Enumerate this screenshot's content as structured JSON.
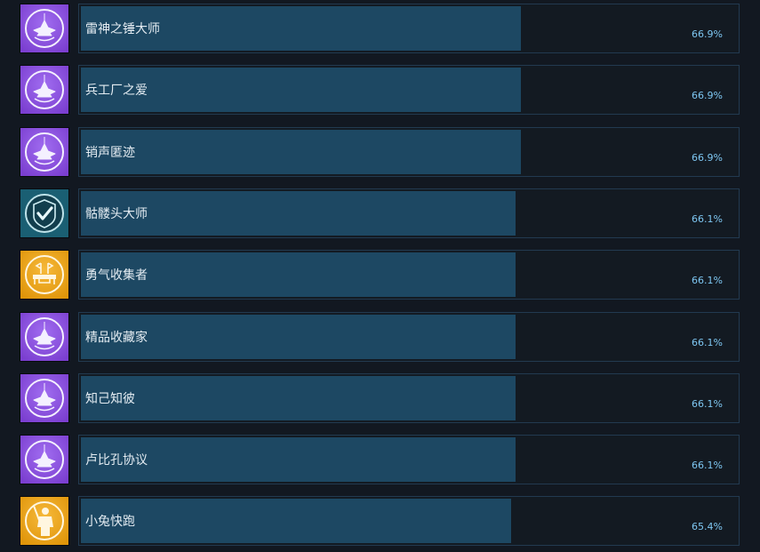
{
  "achievements": [
    {
      "name": "雷神之锤大师",
      "percent_label": "66.9%",
      "percent": 66.9,
      "icon": "tower-icon",
      "icon_color": "#7b3fd0"
    },
    {
      "name": "兵工厂之爱",
      "percent_label": "66.9%",
      "percent": 66.9,
      "icon": "tower-icon",
      "icon_color": "#7b3fd0"
    },
    {
      "name": "销声匿迹",
      "percent_label": "66.9%",
      "percent": 66.9,
      "icon": "tower-icon",
      "icon_color": "#7b3fd0"
    },
    {
      "name": "骷髅头大师",
      "percent_label": "66.1%",
      "percent": 66.1,
      "icon": "checkmark-shield-icon",
      "icon_color": "#1a5f73"
    },
    {
      "name": "勇气收集者",
      "percent_label": "66.1%",
      "percent": 66.1,
      "icon": "flags-desk-icon",
      "icon_color": "#e0950a"
    },
    {
      "name": "精品收藏家",
      "percent_label": "66.1%",
      "percent": 66.1,
      "icon": "tower-icon",
      "icon_color": "#7b3fd0"
    },
    {
      "name": "知己知彼",
      "percent_label": "66.1%",
      "percent": 66.1,
      "icon": "tower-icon",
      "icon_color": "#7b3fd0"
    },
    {
      "name": "卢比孔协议",
      "percent_label": "66.1%",
      "percent": 66.1,
      "icon": "tower-icon",
      "icon_color": "#7b3fd0"
    },
    {
      "name": "小兔快跑",
      "percent_label": "65.4%",
      "percent": 65.4,
      "icon": "soldier-icon",
      "icon_color": "#e0950a"
    }
  ]
}
